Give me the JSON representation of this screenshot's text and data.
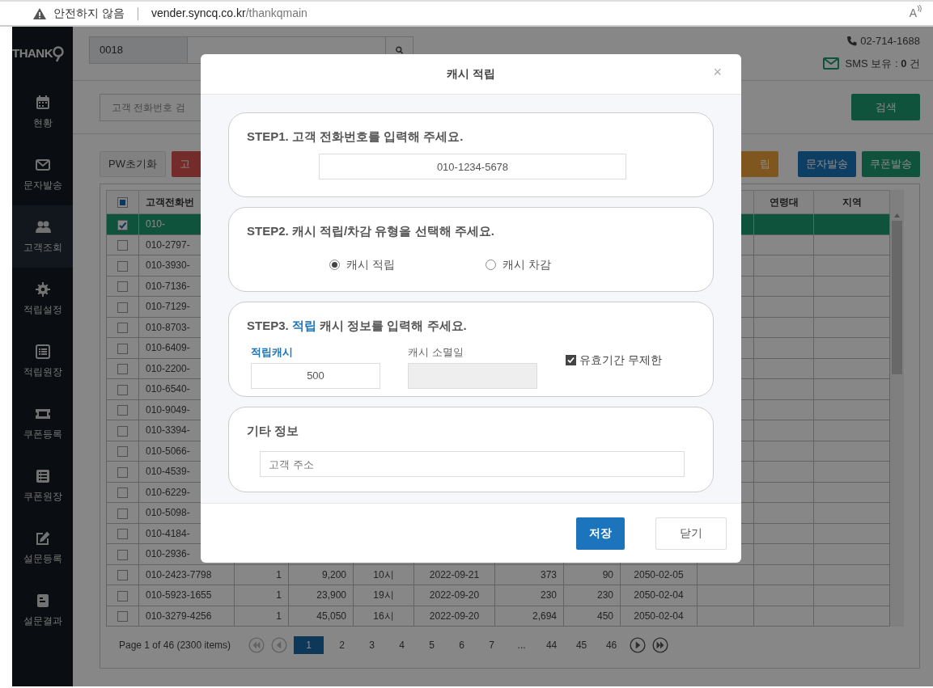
{
  "address_bar": {
    "security_label": "안전하지 않음",
    "url_host": "vender.syncq.co.kr",
    "url_path": "/thankqmain",
    "read_aloud": "A"
  },
  "sidebar": {
    "logo": "THANK",
    "items": [
      {
        "label": "현황",
        "kind": "calendar",
        "selected": false
      },
      {
        "label": "문자발송",
        "kind": "envelope",
        "selected": false
      },
      {
        "label": "고객조회",
        "kind": "users",
        "selected": true
      },
      {
        "label": "적립설정",
        "kind": "gear",
        "selected": false
      },
      {
        "label": "적립원장",
        "kind": "list",
        "selected": false
      },
      {
        "label": "쿠폰등록",
        "kind": "ticket",
        "selected": false
      },
      {
        "label": "쿠폰원장",
        "kind": "bullet-list",
        "selected": false
      },
      {
        "label": "설문등록",
        "kind": "pencil",
        "selected": false
      },
      {
        "label": "설문결과",
        "kind": "document",
        "selected": false
      }
    ]
  },
  "header": {
    "store_code": "0018",
    "phone": "02-714-1688",
    "sms_balance": "SMS 보유 : **0** 건"
  },
  "search": {
    "placeholder": "고객 전화번호 검",
    "button": "검색"
  },
  "actions_left": [
    {
      "label": "PW초기화",
      "kind": "plain"
    },
    {
      "label": "고",
      "kind": "danger"
    }
  ],
  "actions_right": [
    {
      "label": "립",
      "kind": "warning"
    },
    {
      "label": "문자발송",
      "kind": "primary"
    },
    {
      "label": "쿠폰발송",
      "kind": "success"
    }
  ],
  "table": {
    "header_checkbox": {
      "indeterminate": true
    },
    "columns": [
      {
        "label": "고객전화번"
      },
      {},
      {},
      {},
      {},
      {},
      {},
      {},
      {},
      {
        "label": "연령대"
      },
      {
        "label": "지역"
      }
    ],
    "rows": [
      {
        "selected": true,
        "checked": true,
        "cells": [
          "010-"
        ]
      },
      {
        "selected": false,
        "checked": false,
        "cells": [
          "010-2797-"
        ]
      },
      {
        "selected": false,
        "checked": false,
        "cells": [
          "010-3930-"
        ]
      },
      {
        "selected": false,
        "checked": false,
        "cells": [
          "010-7136-"
        ]
      },
      {
        "selected": false,
        "checked": false,
        "cells": [
          "010-7129-"
        ]
      },
      {
        "selected": false,
        "checked": false,
        "cells": [
          "010-8703-"
        ]
      },
      {
        "selected": false,
        "checked": false,
        "cells": [
          "010-6409-"
        ]
      },
      {
        "selected": false,
        "checked": false,
        "cells": [
          "010-2200-"
        ]
      },
      {
        "selected": false,
        "checked": false,
        "cells": [
          "010-6540-"
        ]
      },
      {
        "selected": false,
        "checked": false,
        "cells": [
          "010-9049-"
        ]
      },
      {
        "selected": false,
        "checked": false,
        "cells": [
          "010-3394-"
        ]
      },
      {
        "selected": false,
        "checked": false,
        "cells": [
          "010-5066-"
        ]
      },
      {
        "selected": false,
        "checked": false,
        "cells": [
          "010-4539-"
        ]
      },
      {
        "selected": false,
        "checked": false,
        "cells": [
          "010-6229-"
        ]
      },
      {
        "selected": false,
        "checked": false,
        "cells": [
          "010-5098-"
        ]
      },
      {
        "selected": false,
        "checked": false,
        "cells": [
          "010-4184-"
        ]
      },
      {
        "selected": false,
        "checked": false,
        "cells": [
          "010-2936-"
        ]
      },
      {
        "selected": false,
        "checked": false,
        "cells": [
          "010-2423-7798",
          "1",
          "9,200",
          "10시",
          "2022-09-21",
          "373",
          "90",
          "2050-02-05"
        ]
      },
      {
        "selected": false,
        "checked": false,
        "cells": [
          "010-5923-1655",
          "1",
          "23,900",
          "19시",
          "2022-09-20",
          "230",
          "230",
          "2050-02-04"
        ]
      },
      {
        "selected": false,
        "checked": false,
        "cells": [
          "010-3279-4256",
          "1",
          "45,050",
          "16시",
          "2022-09-20",
          "2,694",
          "450",
          "2050-02-04"
        ]
      }
    ]
  },
  "pagination": {
    "summary": "Page 1 of 46 (2300 items)",
    "nav_before": [
      {
        "kind": "first",
        "disabled": true
      },
      {
        "kind": "prev",
        "disabled": true
      }
    ],
    "pages": [
      {
        "label": "1",
        "selected": true
      },
      {
        "label": "2",
        "selected": false
      },
      {
        "label": "3",
        "selected": false
      },
      {
        "label": "4",
        "selected": false
      },
      {
        "label": "5",
        "selected": false
      },
      {
        "label": "6",
        "selected": false
      },
      {
        "label": "7",
        "selected": false
      },
      {
        "label": "...",
        "selected": false
      },
      {
        "label": "44",
        "selected": false
      },
      {
        "label": "45",
        "selected": false
      },
      {
        "label": "46",
        "selected": false
      }
    ],
    "nav_after": [
      {
        "kind": "next",
        "disabled": false
      },
      {
        "kind": "last",
        "disabled": false
      }
    ]
  },
  "modal": {
    "title": "캐시 적립",
    "close": "×",
    "step1": {
      "title": "STEP1. 고객 전화번호를 입력해 주세요.",
      "phone": "010-1234-5678"
    },
    "step2": {
      "title": "STEP2. 캐시 적립/차감 유형을 선택해 주세요.",
      "options": [
        {
          "label": "캐시 적립",
          "selected": true
        },
        {
          "label": "캐시 차감",
          "selected": false
        }
      ]
    },
    "step3": {
      "title_prefix": "STEP3.",
      "title_highlight": "적립",
      "title_suffix": "캐시 정보를 입력해 주세요.",
      "amount_label": "적립캐시",
      "amount": "500",
      "expiry_label": "캐시 소멸일",
      "expiry_disabled": true,
      "unlimited": {
        "label": "유효기간 무제한",
        "checked": true
      }
    },
    "extra": {
      "title": "기타 정보",
      "address_placeholder": "고객 주소"
    },
    "buttons": [
      {
        "label": "저장",
        "kind": "primary"
      },
      {
        "label": "닫기",
        "kind": "secondary"
      }
    ]
  }
}
